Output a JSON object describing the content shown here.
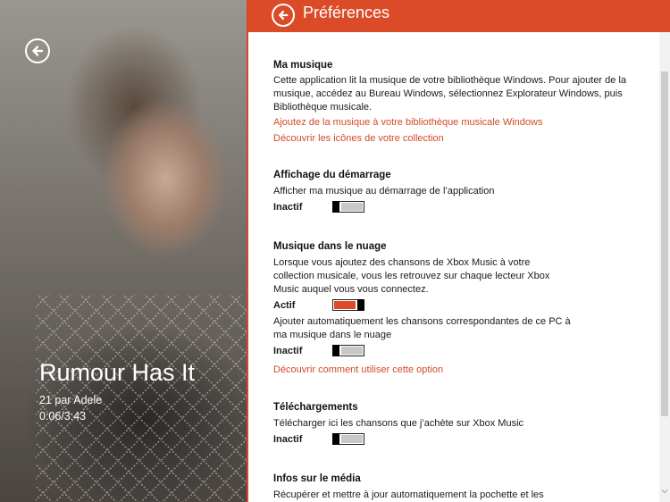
{
  "now_playing": {
    "title": "Rumour Has It",
    "subtitle": "21 par Adele",
    "time": "0:06/3:43"
  },
  "settings": {
    "title": "Préférences",
    "sections": [
      {
        "title": "Ma musique",
        "text": "Cette application lit la musique de votre bibliothèque Windows. Pour ajouter de la musique, accédez au Bureau Windows, sélectionnez Explorateur Windows, puis Bibliothèque musicale.",
        "links": [
          "Ajoutez de la musique à votre bibliothèque musicale Windows",
          "Découvrir les icônes de votre collection"
        ]
      },
      {
        "title": "Affichage du démarrage",
        "text": "Afficher ma musique au démarrage de l’application",
        "state": "Inactif",
        "toggle_on": false
      },
      {
        "title": "Musique dans le nuage",
        "text": "Lorsque vous ajoutez des chansons de Xbox Music à votre collection musicale, vous les retrouvez sur chaque lecteur Xbox Music auquel vous vous connectez.",
        "state": "Actif",
        "toggle_on": true,
        "text2": "Ajouter automatiquement les chansons correspondantes de ce PC à ma musique dans le nuage",
        "state2": "Inactif",
        "toggle2_on": false,
        "link": "Découvrir comment utiliser cette option"
      },
      {
        "title": "Téléchargements",
        "text": "Télécharger ici les chansons que j’achète sur Xbox Music",
        "state": "Inactif",
        "toggle_on": false
      },
      {
        "title": "Infos sur le média",
        "text": "Récupérer et mettre à jour automatiquement la pochette et les"
      }
    ]
  },
  "colors": {
    "accent": "#dc4b27",
    "link": "#d24a28"
  },
  "icons": {
    "back": "back-arrow-icon",
    "scroll_down": "chevron-down-icon"
  }
}
